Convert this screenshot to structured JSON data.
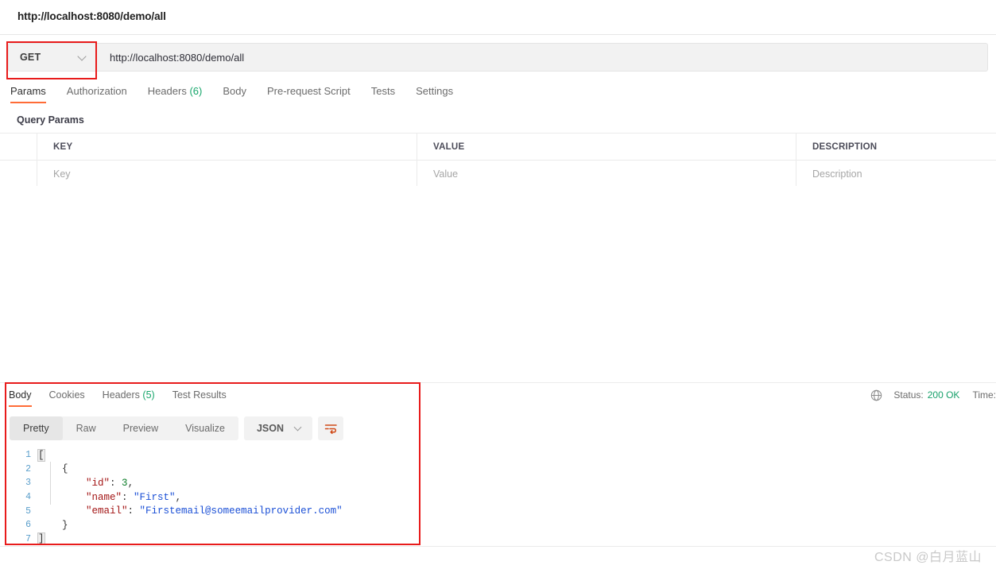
{
  "request_tab": {
    "title": "http://localhost:8080/demo/all"
  },
  "url_bar": {
    "method": "GET",
    "method_caret_icon": "chevron-down-icon",
    "url": "http://localhost:8080/demo/all"
  },
  "request_tabs": [
    {
      "label": "Params",
      "active": true
    },
    {
      "label": "Authorization",
      "active": false
    },
    {
      "label": "Headers",
      "count": "(6)",
      "active": false
    },
    {
      "label": "Body",
      "active": false
    },
    {
      "label": "Pre-request Script",
      "active": false
    },
    {
      "label": "Tests",
      "active": false
    },
    {
      "label": "Settings",
      "active": false
    }
  ],
  "params": {
    "section_title": "Query Params",
    "headers": [
      "KEY",
      "VALUE",
      "DESCRIPTION"
    ],
    "rows": [
      {
        "key": "Key",
        "value": "Value",
        "description": "Description"
      }
    ]
  },
  "response": {
    "tabs": [
      {
        "label": "Body",
        "active": true
      },
      {
        "label": "Cookies",
        "active": false
      },
      {
        "label": "Headers",
        "count": "(5)",
        "active": false
      },
      {
        "label": "Test Results",
        "active": false
      }
    ],
    "globe_icon": "globe-icon",
    "status_label": "Status:",
    "status_value": "200 OK",
    "time_label": "Time:",
    "format_buttons": [
      {
        "label": "Pretty",
        "active": true
      },
      {
        "label": "Raw",
        "active": false
      },
      {
        "label": "Preview",
        "active": false
      },
      {
        "label": "Visualize",
        "active": false
      }
    ],
    "content_type": "JSON",
    "content_type_caret_icon": "chevron-down-icon",
    "wrap_icon": "wrap-text-icon",
    "body_lines": [
      {
        "n": "1",
        "indent": 0,
        "tokens": [
          {
            "t": "[",
            "c": "pun brk"
          }
        ]
      },
      {
        "n": "2",
        "indent": 1,
        "tokens": [
          {
            "t": "{",
            "c": "pun"
          }
        ]
      },
      {
        "n": "3",
        "indent": 2,
        "tokens": [
          {
            "t": "\"id\"",
            "c": "key"
          },
          {
            "t": ": ",
            "c": "pun"
          },
          {
            "t": "3",
            "c": "num"
          },
          {
            "t": ",",
            "c": "pun"
          }
        ]
      },
      {
        "n": "4",
        "indent": 2,
        "tokens": [
          {
            "t": "\"name\"",
            "c": "key"
          },
          {
            "t": ": ",
            "c": "pun"
          },
          {
            "t": "\"First\"",
            "c": "str"
          },
          {
            "t": ",",
            "c": "pun"
          }
        ]
      },
      {
        "n": "5",
        "indent": 2,
        "tokens": [
          {
            "t": "\"email\"",
            "c": "key"
          },
          {
            "t": ": ",
            "c": "pun"
          },
          {
            "t": "\"Firstemail@someemailprovider.com\"",
            "c": "str"
          }
        ]
      },
      {
        "n": "6",
        "indent": 1,
        "tokens": [
          {
            "t": "}",
            "c": "pun"
          }
        ]
      },
      {
        "n": "7",
        "indent": 0,
        "tokens": [
          {
            "t": "]",
            "c": "pun brk"
          }
        ]
      }
    ]
  },
  "watermark": "CSDN @白月蓝山",
  "colors": {
    "accent": "#ff6c37",
    "annotation": "#e81b1b",
    "status_ok": "#16a06a",
    "count_badge": "#17a66b"
  }
}
